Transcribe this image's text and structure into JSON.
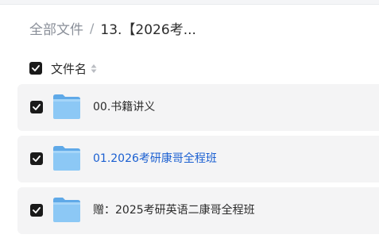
{
  "breadcrumb": {
    "root": "全部文件",
    "separator": "/",
    "current": "13.【2026考..."
  },
  "table": {
    "header_label": "文件名",
    "header_checked": true
  },
  "files": [
    {
      "name": "00.书籍讲义",
      "type": "folder",
      "checked": true
    },
    {
      "name": "01.2026考研康哥全程班",
      "type": "folder",
      "checked": true,
      "highlighted": true
    },
    {
      "name": "赠：2025考研英语二康哥全程班",
      "type": "folder",
      "checked": true
    }
  ],
  "colors": {
    "checkbox": "#1a1a1a",
    "row_background": "#f4f4f5",
    "folder": "#7fc0f2",
    "link": "#1a5fd1"
  }
}
